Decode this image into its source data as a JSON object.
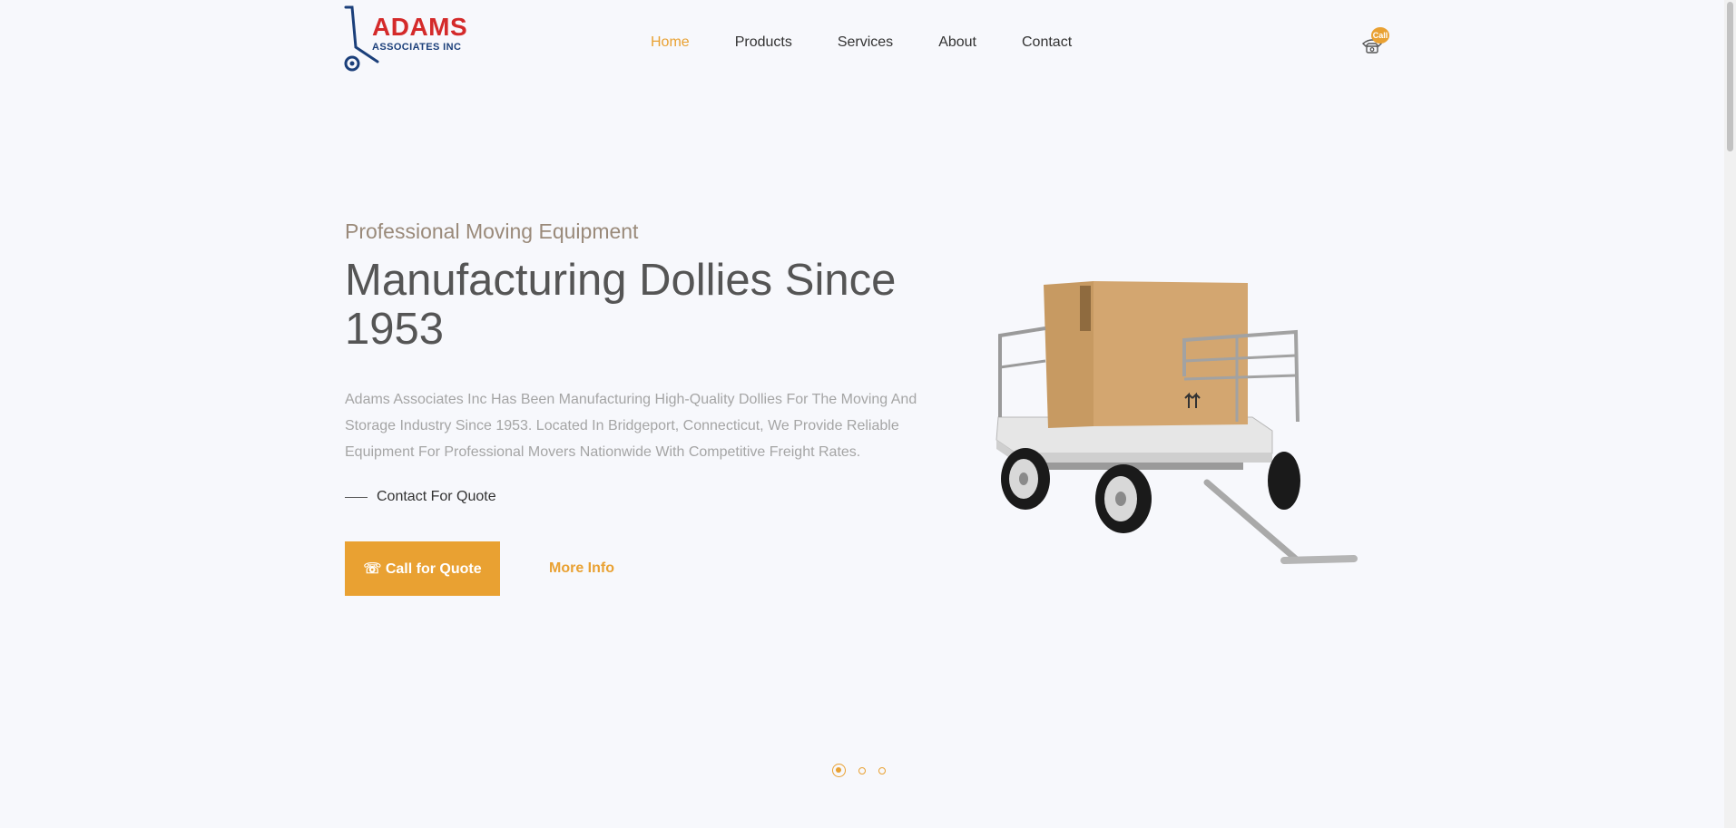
{
  "brand": {
    "name": "ADAMS",
    "tagline": "ASSOCIATES INC",
    "color_primary": "#d42a2a",
    "color_secondary": "#1b3f7a"
  },
  "nav": {
    "items": [
      {
        "label": "Home",
        "active": true
      },
      {
        "label": "Products",
        "active": false
      },
      {
        "label": "Services",
        "active": false
      },
      {
        "label": "About",
        "active": false
      },
      {
        "label": "Contact",
        "active": false
      }
    ],
    "call_badge": "Call",
    "call_icon": "phone-icon"
  },
  "hero": {
    "eyebrow": "Professional Moving Equipment",
    "headline": "Manufacturing Dollies Since 1953",
    "description": "Adams Associates Inc Has Been Manufacturing High-Quality Dollies For The Moving And Storage Industry Since 1953. Located In Bridgeport, Connecticut, We Provide Reliable Equipment For Professional Movers Nationwide With Competitive Freight Rates.",
    "cta_text": "Contact For Quote",
    "primary_button": "☏ Call for Quote",
    "secondary_link": "More Info"
  },
  "slider": {
    "count": 3,
    "active_index": 0
  },
  "colors": {
    "accent": "#e9a132",
    "background": "#f7f8fc",
    "text": "#555555"
  }
}
